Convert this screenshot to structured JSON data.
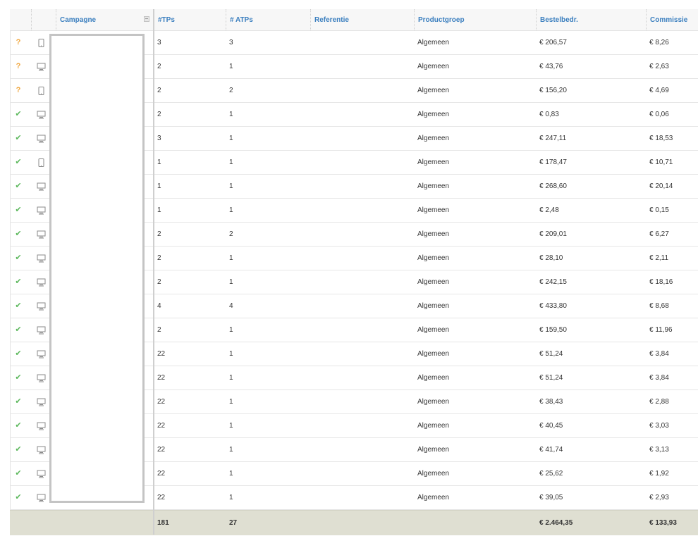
{
  "columns": {
    "campagne": "Campagne",
    "tps": "#TPs",
    "atps": "# ATPs",
    "referentie": "Referentie",
    "productgroep": "Productgroep",
    "bestelbedrag": "Bestelbedr.",
    "commissie": "Commissie"
  },
  "rows": [
    {
      "status": "?",
      "device": "tablet-icon",
      "tps": "3",
      "atps": "3",
      "referentie": "",
      "productgroep": "Algemeen",
      "bestelbedrag": "€ 206,57",
      "commissie": "€ 8,26"
    },
    {
      "status": "?",
      "device": "desktop-icon",
      "tps": "2",
      "atps": "1",
      "referentie": "",
      "productgroep": "Algemeen",
      "bestelbedrag": "€ 43,76",
      "commissie": "€ 2,63"
    },
    {
      "status": "?",
      "device": "tablet-icon",
      "tps": "2",
      "atps": "2",
      "referentie": "",
      "productgroep": "Algemeen",
      "bestelbedrag": "€ 156,20",
      "commissie": "€ 4,69"
    },
    {
      "status": "✔",
      "device": "desktop-icon",
      "tps": "2",
      "atps": "1",
      "referentie": "",
      "productgroep": "Algemeen",
      "bestelbedrag": "€ 0,83",
      "commissie": "€ 0,06"
    },
    {
      "status": "✔",
      "device": "desktop-icon",
      "tps": "3",
      "atps": "1",
      "referentie": "",
      "productgroep": "Algemeen",
      "bestelbedrag": "€ 247,11",
      "commissie": "€ 18,53"
    },
    {
      "status": "✔",
      "device": "tablet-icon",
      "tps": "1",
      "atps": "1",
      "referentie": "",
      "productgroep": "Algemeen",
      "bestelbedrag": "€ 178,47",
      "commissie": "€ 10,71"
    },
    {
      "status": "✔",
      "device": "desktop-icon",
      "tps": "1",
      "atps": "1",
      "referentie": "",
      "productgroep": "Algemeen",
      "bestelbedrag": "€ 268,60",
      "commissie": "€ 20,14"
    },
    {
      "status": "✔",
      "device": "desktop-icon",
      "tps": "1",
      "atps": "1",
      "referentie": "",
      "productgroep": "Algemeen",
      "bestelbedrag": "€ 2,48",
      "commissie": "€ 0,15"
    },
    {
      "status": "✔",
      "device": "desktop-icon",
      "tps": "2",
      "atps": "2",
      "referentie": "",
      "productgroep": "Algemeen",
      "bestelbedrag": "€ 209,01",
      "commissie": "€ 6,27"
    },
    {
      "status": "✔",
      "device": "desktop-icon",
      "tps": "2",
      "atps": "1",
      "referentie": "",
      "productgroep": "Algemeen",
      "bestelbedrag": "€ 28,10",
      "commissie": "€ 2,11"
    },
    {
      "status": "✔",
      "device": "desktop-icon",
      "tps": "2",
      "atps": "1",
      "referentie": "",
      "productgroep": "Algemeen",
      "bestelbedrag": "€ 242,15",
      "commissie": "€ 18,16"
    },
    {
      "status": "✔",
      "device": "desktop-icon",
      "tps": "4",
      "atps": "4",
      "referentie": "",
      "productgroep": "Algemeen",
      "bestelbedrag": "€ 433,80",
      "commissie": "€ 8,68"
    },
    {
      "status": "✔",
      "device": "desktop-icon",
      "tps": "2",
      "atps": "1",
      "referentie": "",
      "productgroep": "Algemeen",
      "bestelbedrag": "€ 159,50",
      "commissie": "€ 11,96"
    },
    {
      "status": "✔",
      "device": "desktop-icon",
      "tps": "22",
      "atps": "1",
      "referentie": "",
      "productgroep": "Algemeen",
      "bestelbedrag": "€ 51,24",
      "commissie": "€ 3,84"
    },
    {
      "status": "✔",
      "device": "desktop-icon",
      "tps": "22",
      "atps": "1",
      "referentie": "",
      "productgroep": "Algemeen",
      "bestelbedrag": "€ 51,24",
      "commissie": "€ 3,84"
    },
    {
      "status": "✔",
      "device": "desktop-icon",
      "tps": "22",
      "atps": "1",
      "referentie": "",
      "productgroep": "Algemeen",
      "bestelbedrag": "€ 38,43",
      "commissie": "€ 2,88"
    },
    {
      "status": "✔",
      "device": "desktop-icon",
      "tps": "22",
      "atps": "1",
      "referentie": "",
      "productgroep": "Algemeen",
      "bestelbedrag": "€ 40,45",
      "commissie": "€ 3,03"
    },
    {
      "status": "✔",
      "device": "desktop-icon",
      "tps": "22",
      "atps": "1",
      "referentie": "",
      "productgroep": "Algemeen",
      "bestelbedrag": "€ 41,74",
      "commissie": "€ 3,13"
    },
    {
      "status": "✔",
      "device": "desktop-icon",
      "tps": "22",
      "atps": "1",
      "referentie": "",
      "productgroep": "Algemeen",
      "bestelbedrag": "€ 25,62",
      "commissie": "€ 1,92"
    },
    {
      "status": "✔",
      "device": "desktop-icon",
      "tps": "22",
      "atps": "1",
      "referentie": "",
      "productgroep": "Algemeen",
      "bestelbedrag": "€ 39,05",
      "commissie": "€ 2,93"
    }
  ],
  "totals": {
    "tps": "181",
    "atps": "27",
    "bestelbedrag": "€ 2.464,35",
    "commissie": "€ 133,93"
  },
  "colors": {
    "header_text": "#3b7fbf",
    "status_pending": "#f0a53b",
    "status_ok": "#5cb85c",
    "totals_bg": "#dfdfd2"
  }
}
